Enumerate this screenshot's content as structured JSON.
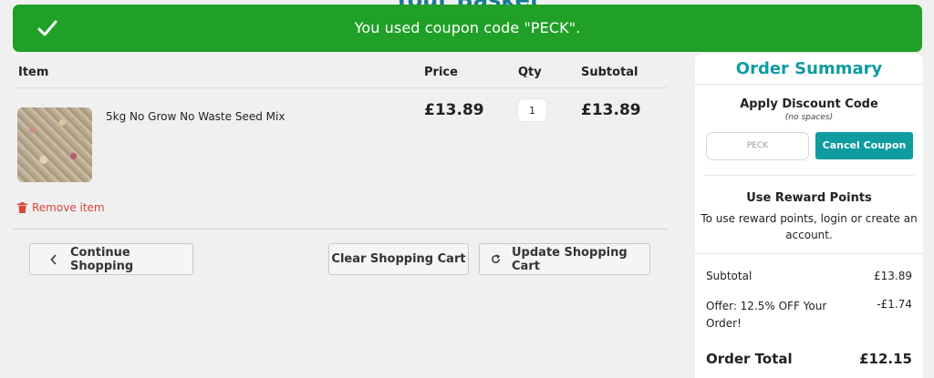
{
  "page": {
    "title_peek": "Your Basket"
  },
  "banner": {
    "message": "You used coupon code \"PECK\".",
    "icon": "check-icon",
    "color": "#21a027"
  },
  "cart": {
    "headers": {
      "item": "Item",
      "price": "Price",
      "qty": "Qty",
      "subtotal": "Subtotal"
    },
    "items": [
      {
        "name": "5kg No Grow No Waste Seed Mix",
        "price": "£13.89",
        "qty": "1",
        "subtotal": "£13.89"
      }
    ],
    "remove_label": "Remove item",
    "buttons": {
      "continue": "Continue Shopping",
      "clear": "Clear Shopping Cart",
      "update": "Update Shopping Cart"
    }
  },
  "summary": {
    "title": "Order Summary",
    "discount": {
      "heading": "Apply Discount Code",
      "note": "(no spaces)",
      "code_value": "PECK",
      "button": "Cancel Coupon"
    },
    "rewards": {
      "heading": "Use Reward Points",
      "text": "To use reward points, login or create an account."
    },
    "totals": {
      "subtotal_label": "Subtotal",
      "subtotal_value": "£13.89",
      "offer_label": "Offer: 12.5% OFF Your Order!",
      "offer_value": "-£1.74",
      "order_total_label": "Order Total",
      "order_total_value": "£12.15"
    },
    "accent_color": "#0e9ca0"
  }
}
